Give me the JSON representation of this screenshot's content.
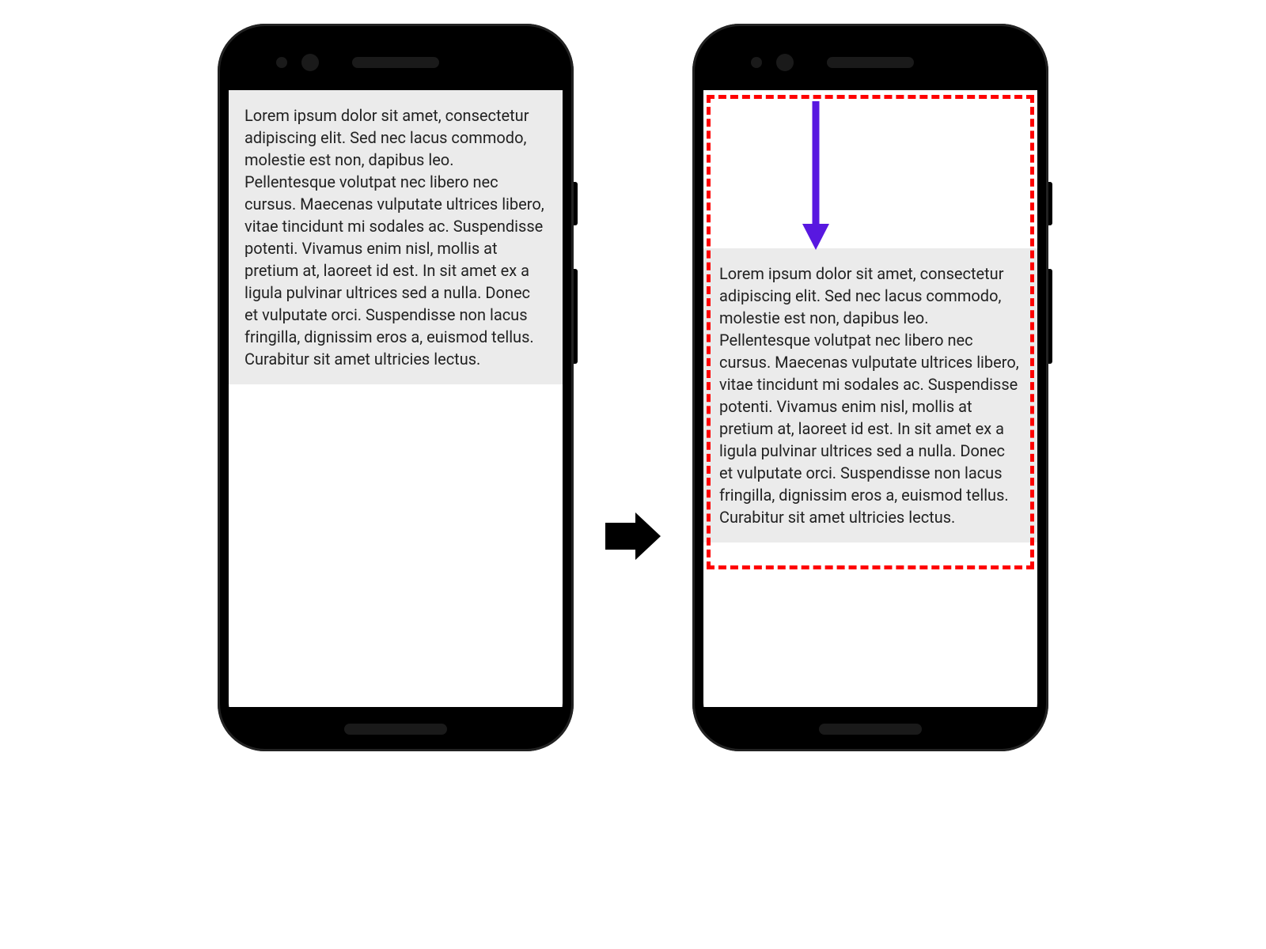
{
  "text_content": "Lorem ipsum dolor sit amet, consectetur adipiscing elit. Sed nec lacus commodo, molestie est non, dapibus leo. Pellentesque volutpat nec libero nec cursus. Maecenas vulputate ultrices libero, vitae tincidunt mi sodales ac. Suspendisse potenti. Vivamus enim nisl, mollis at pretium at, laoreet id est. In sit amet ex a ligula pulvinar ultrices sed a nulla. Donec et vulputate orci. Suspendisse non lacus fringilla, dignissim eros a, euismod tellus. Curabitur sit amet ultricies lectus.",
  "colors": {
    "highlight_border": "#ff0000",
    "scroll_arrow": "#5818e0",
    "text_bg": "#ebebeb"
  }
}
